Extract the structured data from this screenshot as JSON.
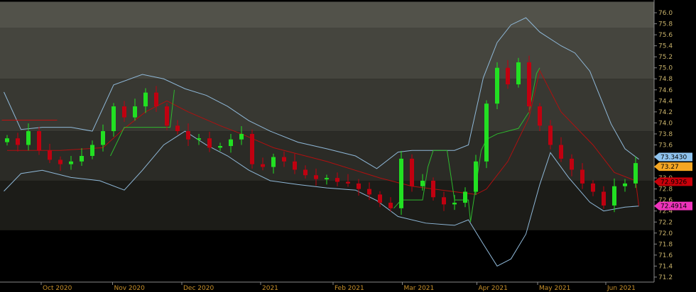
{
  "chart_data": {
    "type": "candlestick",
    "title": "",
    "xlabel": "",
    "ylabel": "",
    "ylim": [
      71.2,
      76.0
    ],
    "grid": false,
    "y_ticks": [
      "76.0",
      "75.8",
      "75.6",
      "75.4",
      "75.2",
      "75.0",
      "74.8",
      "74.6",
      "74.4",
      "74.2",
      "74.0",
      "73.8",
      "73.6",
      "73.4",
      "73.2",
      "73.0",
      "72.8",
      "72.6",
      "72.4",
      "72.2",
      "72.0",
      "71.8",
      "71.6",
      "71.4",
      "71.2"
    ],
    "x_ticks": [
      {
        "label": "Oct 2020",
        "index": 3.2
      },
      {
        "label": "Nov 2020",
        "index": 9.9
      },
      {
        "label": "Dec 2020",
        "index": 16.4
      },
      {
        "label": "2021",
        "index": 23.8
      },
      {
        "label": "Feb 2021",
        "index": 30.6
      },
      {
        "label": "Mar 2021",
        "index": 37.1
      },
      {
        "label": "Apr 2021",
        "index": 44.1
      },
      {
        "label": "May 2021",
        "index": 49.8
      },
      {
        "label": "Jun 2021",
        "index": 56.2
      }
    ],
    "first_open": 73.65,
    "close": [
      73.72,
      73.6,
      73.85,
      73.5,
      73.33,
      73.25,
      73.3,
      73.4,
      73.6,
      73.85,
      74.3,
      74.1,
      74.3,
      74.55,
      74.3,
      73.95,
      73.85,
      73.7,
      73.72,
      73.55,
      73.58,
      73.7,
      73.8,
      73.25,
      73.2,
      73.38,
      73.3,
      73.15,
      73.05,
      72.98,
      73.0,
      72.93,
      72.9,
      72.8,
      72.7,
      72.55,
      72.45,
      73.35,
      72.85,
      72.95,
      72.65,
      72.52,
      72.55,
      72.75,
      73.3,
      74.35,
      75.0,
      74.7,
      75.1,
      74.3,
      73.95,
      73.6,
      73.35,
      73.15,
      72.9,
      72.75,
      72.5,
      72.85,
      72.9,
      73.27
    ],
    "upper_band": [
      [
        -0.3,
        74.56
      ],
      [
        1.3,
        73.88
      ],
      [
        3.3,
        73.92
      ],
      [
        6,
        73.92
      ],
      [
        8,
        73.85
      ],
      [
        10,
        74.69
      ],
      [
        12.7,
        74.88
      ],
      [
        14.7,
        74.8
      ],
      [
        16.7,
        74.62
      ],
      [
        18.7,
        74.5
      ],
      [
        20.7,
        74.3
      ],
      [
        22.7,
        74.04
      ],
      [
        24.7,
        73.85
      ],
      [
        27.3,
        73.65
      ],
      [
        30,
        73.53
      ],
      [
        32.7,
        73.4
      ],
      [
        34.7,
        73.17
      ],
      [
        36.7,
        73.47
      ],
      [
        38,
        73.5
      ],
      [
        42,
        73.5
      ],
      [
        43.3,
        73.6
      ],
      [
        44.7,
        74.82
      ],
      [
        46,
        75.46
      ],
      [
        47.3,
        75.78
      ],
      [
        48.7,
        75.91
      ],
      [
        50,
        75.65
      ],
      [
        52,
        75.4
      ],
      [
        53.3,
        75.27
      ],
      [
        54.7,
        74.94
      ],
      [
        56.7,
        73.98
      ],
      [
        58,
        73.53
      ],
      [
        59.3,
        73.34
      ]
    ],
    "lower_band": [
      [
        -0.3,
        72.76
      ],
      [
        1.3,
        73.08
      ],
      [
        3.3,
        73.14
      ],
      [
        6,
        73.01
      ],
      [
        8.7,
        72.95
      ],
      [
        11,
        72.78
      ],
      [
        12.7,
        73.14
      ],
      [
        14.7,
        73.6
      ],
      [
        16.7,
        73.85
      ],
      [
        18.7,
        73.6
      ],
      [
        20.7,
        73.4
      ],
      [
        22.7,
        73.14
      ],
      [
        24.7,
        72.95
      ],
      [
        27.3,
        72.88
      ],
      [
        30,
        72.82
      ],
      [
        32.7,
        72.78
      ],
      [
        34.7,
        72.59
      ],
      [
        36.7,
        72.3
      ],
      [
        39.3,
        72.18
      ],
      [
        42,
        72.14
      ],
      [
        43.3,
        72.24
      ],
      [
        44.7,
        71.8
      ],
      [
        46,
        71.4
      ],
      [
        47.3,
        71.53
      ],
      [
        48.7,
        71.98
      ],
      [
        50,
        72.88
      ],
      [
        51,
        73.46
      ],
      [
        52.7,
        73.01
      ],
      [
        54.7,
        72.56
      ],
      [
        56,
        72.4
      ],
      [
        58,
        72.47
      ],
      [
        59.3,
        72.49
      ]
    ],
    "red_line": [
      [
        0,
        73.5
      ],
      [
        5,
        73.5
      ],
      [
        9,
        73.55
      ],
      [
        11,
        73.9
      ],
      [
        13,
        74.2
      ],
      [
        15,
        74.4
      ],
      [
        17,
        74.2
      ],
      [
        20,
        73.95
      ],
      [
        22,
        73.8
      ],
      [
        25,
        73.55
      ],
      [
        30,
        73.3
      ],
      [
        35,
        73.0
      ],
      [
        38,
        72.85
      ],
      [
        42,
        72.75
      ],
      [
        44,
        72.7
      ],
      [
        45,
        72.8
      ],
      [
        47,
        73.3
      ],
      [
        49,
        74.1
      ],
      [
        50,
        74.95
      ],
      [
        52,
        74.2
      ],
      [
        55,
        73.6
      ],
      [
        57,
        73.1
      ],
      [
        59,
        72.95
      ],
      [
        59.3,
        72.49
      ]
    ],
    "green_step": [
      [
        9.7,
        73.4
      ],
      [
        11,
        73.92
      ],
      [
        15.3,
        73.92
      ],
      [
        15.7,
        74.6
      ]
    ],
    "green_step2": [
      [
        36.3,
        72.45
      ],
      [
        37,
        72.6
      ],
      [
        39,
        72.6
      ],
      [
        39.5,
        73.2
      ],
      [
        40,
        73.5
      ],
      [
        41.3,
        73.5
      ],
      [
        42,
        72.6
      ],
      [
        43.3,
        72.6
      ],
      [
        43.5,
        72.2
      ],
      [
        44.5,
        73.5
      ],
      [
        45,
        73.7
      ],
      [
        46,
        73.8
      ],
      [
        48,
        73.9
      ],
      [
        49,
        74.2
      ],
      [
        49.7,
        74.9
      ],
      [
        50,
        75.0
      ]
    ],
    "red_step": [
      [
        -0.5,
        74.05
      ],
      [
        4.7,
        74.05
      ]
    ],
    "price_tags": [
      {
        "label": "73.3430",
        "value": 73.343,
        "color": "#8fc3ee"
      },
      {
        "label": "73.27",
        "value": 73.27,
        "color": "#f5a623"
      },
      {
        "label": "72.9326",
        "value": 72.9326,
        "color": "#c8000a"
      },
      {
        "label": "72.4914",
        "value": 72.4914,
        "color": "#ee33bb"
      }
    ],
    "bands": [
      {
        "from": 76.2,
        "to": 75.72,
        "color": "#52524a"
      },
      {
        "from": 75.72,
        "to": 74.8,
        "color": "#45453e"
      },
      {
        "from": 74.8,
        "to": 73.85,
        "color": "#383832"
      },
      {
        "from": 73.85,
        "to": 72.95,
        "color": "#2b2b26"
      },
      {
        "from": 72.95,
        "to": 72.05,
        "color": "#1c1c18"
      },
      {
        "from": 72.05,
        "to": 71.0,
        "color": "#000000"
      }
    ]
  }
}
